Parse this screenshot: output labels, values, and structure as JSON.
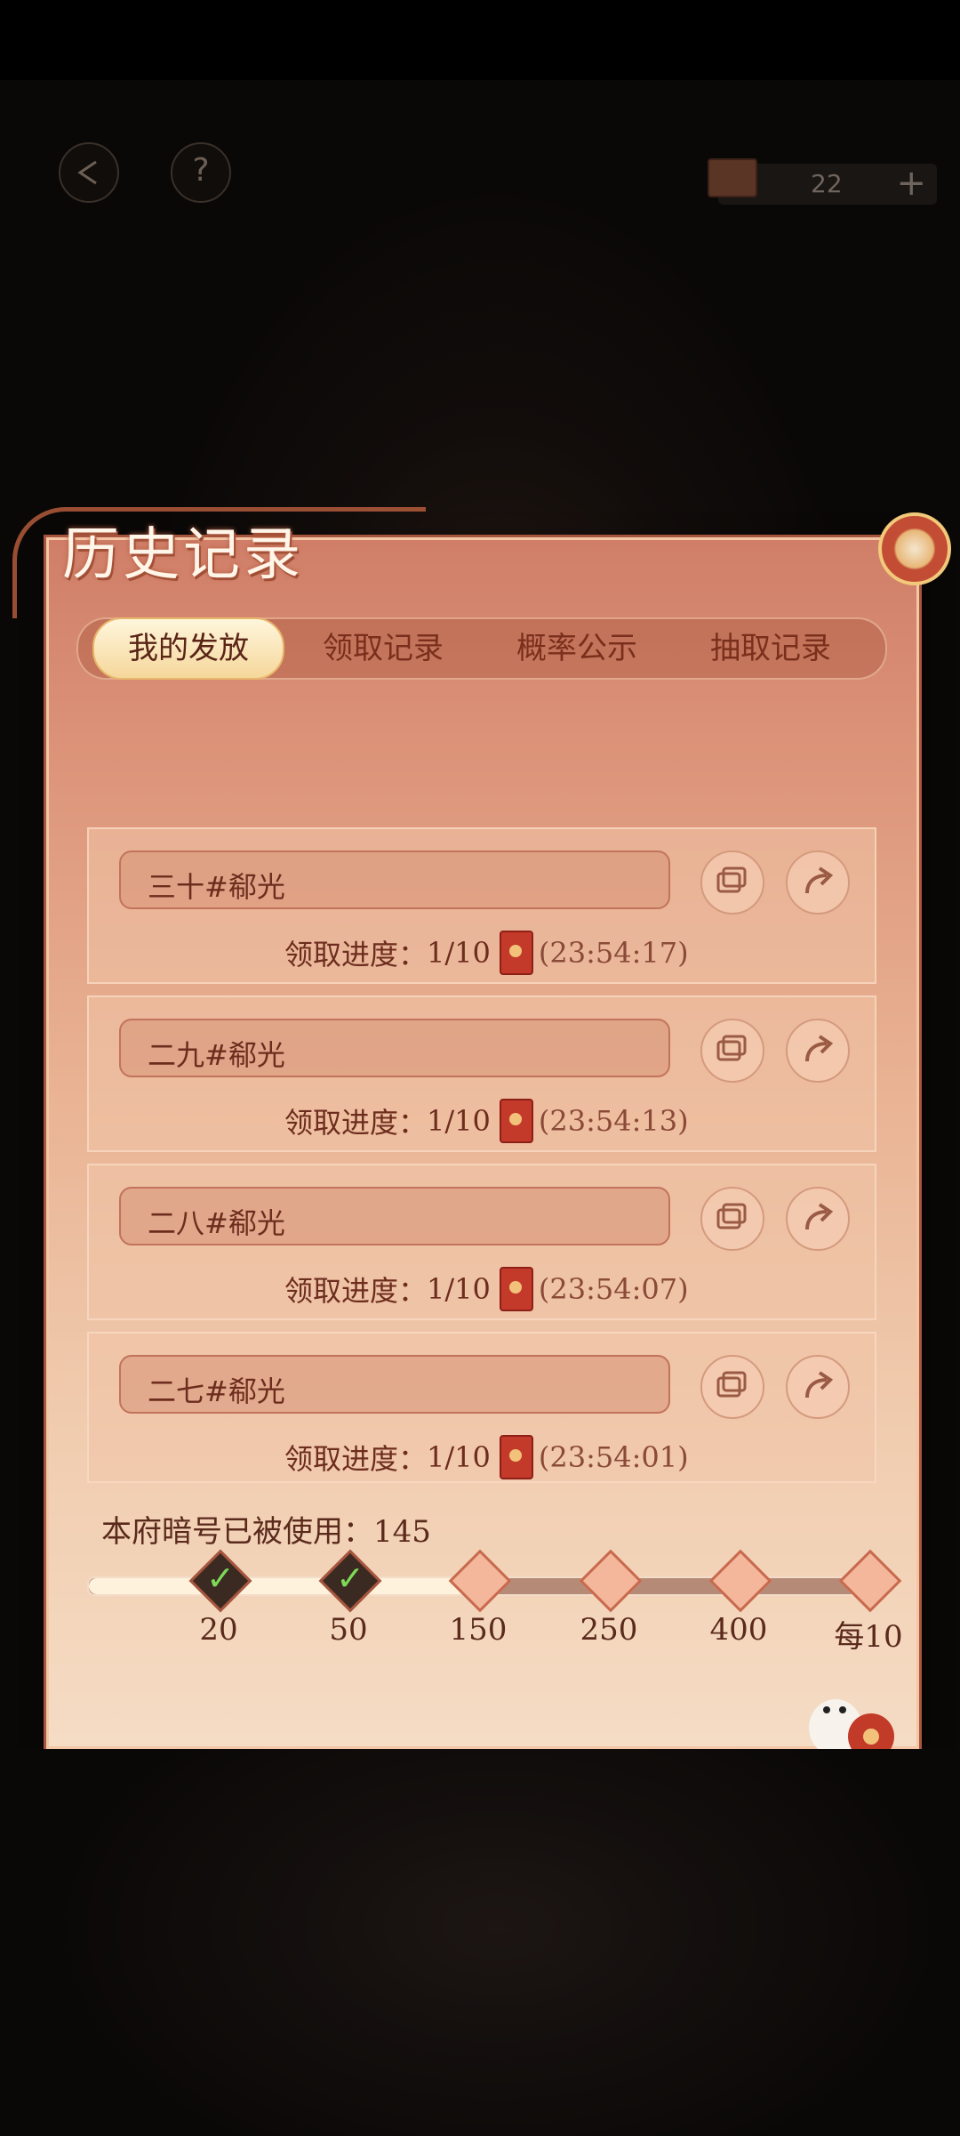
{
  "header": {
    "back_icon": "back-arrow-icon",
    "help_label": "?",
    "currency_value": "22",
    "currency_add": "+"
  },
  "panel": {
    "title": "历史记录",
    "tabs": [
      {
        "label": "我的发放",
        "active": true
      },
      {
        "label": "领取记录",
        "active": false
      },
      {
        "label": "概率公示",
        "active": false
      },
      {
        "label": "抽取记录",
        "active": false
      }
    ]
  },
  "records": [
    {
      "name": "三十#郗光",
      "progress_label": "领取进度：",
      "progress": "1/10",
      "time": "(23:54:17)"
    },
    {
      "name": "二九#郗光",
      "progress_label": "领取进度：",
      "progress": "1/10",
      "time": "(23:54:13)"
    },
    {
      "name": "二八#郗光",
      "progress_label": "领取进度：",
      "progress": "1/10",
      "time": "(23:54:07)"
    },
    {
      "name": "二七#郗光",
      "progress_label": "领取进度：",
      "progress": "1/10",
      "time": "(23:54:01)"
    }
  ],
  "usage": {
    "text": "本府暗号已被使用：145",
    "milestones": [
      {
        "label": "20",
        "done": true
      },
      {
        "label": "50",
        "done": true
      },
      {
        "label": "150",
        "done": false
      },
      {
        "label": "250",
        "done": false
      },
      {
        "label": "400",
        "done": false
      },
      {
        "label": "每10",
        "done": false
      }
    ],
    "progress_fraction": 0.475
  },
  "colors": {
    "panel_top": "#d07e68",
    "panel_bottom": "#f5dcc4",
    "text_dark": "#6d2d1e",
    "check_green": "#7ed957"
  }
}
